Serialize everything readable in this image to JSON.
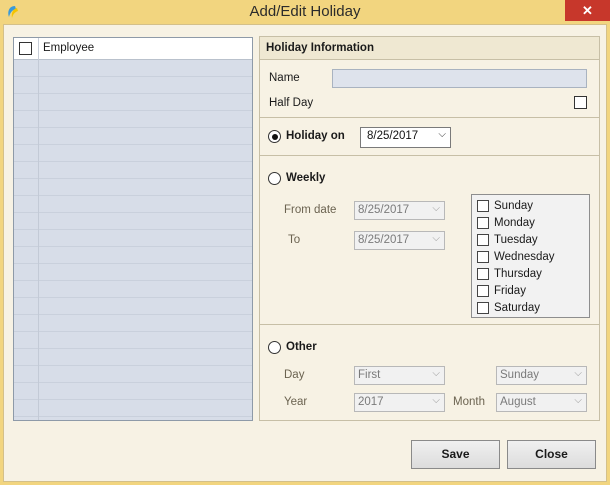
{
  "window": {
    "title": "Add/Edit Holiday",
    "close_glyph": "✕"
  },
  "employees": {
    "header": "Employee",
    "rows": []
  },
  "holiday_info": {
    "header": "Holiday Information",
    "name_label": "Name",
    "name_value": "",
    "half_day_label": "Half Day",
    "half_day_checked": false
  },
  "holiday_on": {
    "label": "Holiday on",
    "selected": true,
    "date": "8/25/2017"
  },
  "weekly": {
    "label": "Weekly",
    "selected": false,
    "from_label": "From date",
    "from_value": "8/25/2017",
    "to_label": "To",
    "to_value": "8/25/2017",
    "days": [
      "Sunday",
      "Monday",
      "Tuesday",
      "Wednesday",
      "Thursday",
      "Friday",
      "Saturday"
    ]
  },
  "other": {
    "label": "Other",
    "selected": false,
    "day_label": "Day",
    "day_value": "First",
    "weekday_value": "Sunday",
    "year_label": "Year",
    "year_value": "2017",
    "month_label": "Month",
    "month_value": "August"
  },
  "buttons": {
    "save": "Save",
    "close": "Close"
  },
  "colors": {
    "titlebar": "#f2d57f",
    "window_bg": "#f7f2e4",
    "grid_bg": "#d7dde8",
    "close_bg": "#c7372b"
  },
  "icons": {
    "app": "app-logo-icon",
    "dropdown": "chevron-down-icon"
  }
}
